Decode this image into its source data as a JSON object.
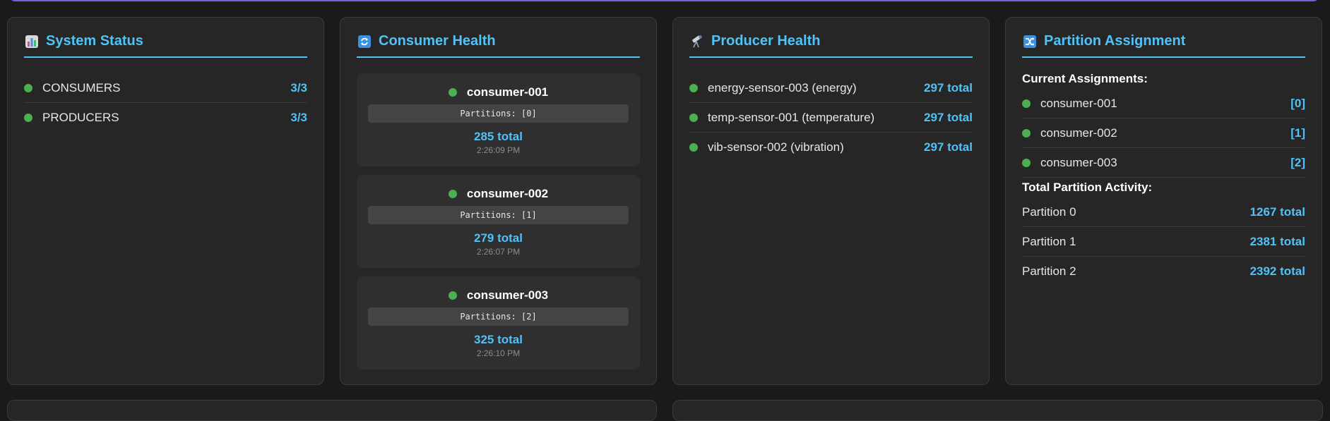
{
  "cards": {
    "system": {
      "title": "System Status",
      "icon": "chart-icon",
      "rows": [
        {
          "label": "CONSUMERS",
          "value": "3/3"
        },
        {
          "label": "PRODUCERS",
          "value": "3/3"
        }
      ]
    },
    "consumers": {
      "title": "Consumer Health",
      "icon": "refresh-icon",
      "items": [
        {
          "name": "consumer-001",
          "partitions": "Partitions: [0]",
          "total": "285 total",
          "time": "2:26:09 PM"
        },
        {
          "name": "consumer-002",
          "partitions": "Partitions: [1]",
          "total": "279 total",
          "time": "2:26:07 PM"
        },
        {
          "name": "consumer-003",
          "partitions": "Partitions: [2]",
          "total": "325 total",
          "time": "2:26:10 PM"
        }
      ]
    },
    "producers": {
      "title": "Producer Health",
      "icon": "telescope-icon",
      "rows": [
        {
          "label": "energy-sensor-003 (energy)",
          "value": "297 total"
        },
        {
          "label": "temp-sensor-001 (temperature)",
          "value": "297 total"
        },
        {
          "label": "vib-sensor-002 (vibration)",
          "value": "297 total"
        }
      ]
    },
    "partitions": {
      "title": "Partition Assignment",
      "icon": "shuffle-icon",
      "current_heading": "Current Assignments:",
      "assignments": [
        {
          "label": "consumer-001",
          "value": "[0]"
        },
        {
          "label": "consumer-002",
          "value": "[1]"
        },
        {
          "label": "consumer-003",
          "value": "[2]"
        }
      ],
      "activity_heading": "Total Partition Activity:",
      "activity": [
        {
          "label": "Partition 0",
          "value": "1267 total"
        },
        {
          "label": "Partition 1",
          "value": "2381 total"
        },
        {
          "label": "Partition 2",
          "value": "2392 total"
        }
      ]
    }
  },
  "colors": {
    "accent": "#4fc3f7",
    "status_ok": "#4caf50",
    "card_bg": "#262626",
    "page_bg": "#1a1a1a"
  }
}
